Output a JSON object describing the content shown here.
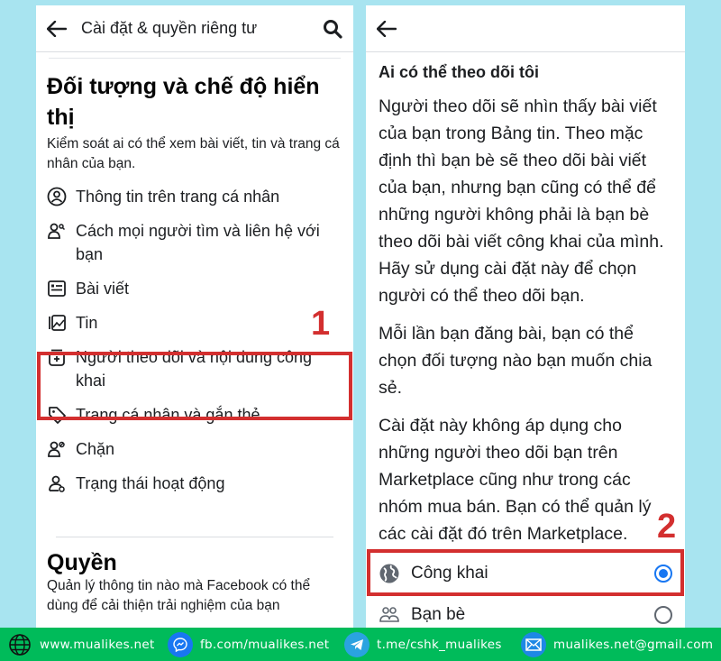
{
  "left": {
    "topbar": {
      "title": "Cài đặt & quyền riêng tư"
    },
    "section": {
      "title": "Đối tượng và chế độ hiển thị",
      "description": "Kiểm soát ai có thể xem bài viết, tin và trang cá nhân của bạn."
    },
    "menu": [
      {
        "label": "Thông tin trên trang cá nhân",
        "icon": "profile-icon"
      },
      {
        "label": "Cách mọi người tìm và liên hệ với bạn",
        "icon": "people-search-icon"
      },
      {
        "label": "Bài viết",
        "icon": "posts-icon"
      },
      {
        "label": "Tin",
        "icon": "stories-icon"
      },
      {
        "label": "Người theo dõi và nội dung công khai",
        "icon": "followers-icon",
        "highlighted": true
      },
      {
        "label": "Trang cá nhân và gắn thẻ",
        "icon": "tag-icon"
      },
      {
        "label": "Chặn",
        "icon": "block-user-icon"
      },
      {
        "label": "Trạng thái hoạt động",
        "icon": "active-status-icon"
      }
    ],
    "permissions": {
      "title": "Quyền",
      "description": "Quản lý thông tin nào mà Facebook có thể dùng để cải thiện trải nghiệm của bạn"
    },
    "step_label": "1"
  },
  "right": {
    "heading": "Ai có thể theo dõi tôi",
    "paragraphs": [
      "Người theo dõi sẽ nhìn thấy bài viết của bạn trong Bảng tin. Theo mặc định thì bạn bè sẽ theo dõi bài viết của bạn, nhưng bạn cũng có thể để những người không phải là bạn bè theo dõi bài viết công khai của mình. Hãy sử dụng cài đặt này để chọn người có thể theo dõi bạn.",
      "Mỗi lần bạn đăng bài, bạn có thể chọn đối tượng nào bạn muốn chia sẻ.",
      "Cài đặt này không áp dụng cho những người theo dõi bạn trên Marketplace cũng như trong các nhóm mua bán. Bạn có thể quản lý các cài đặt đó trên Marketplace."
    ],
    "options": [
      {
        "label": "Công khai",
        "icon": "globe-icon",
        "selected": true
      },
      {
        "label": "Bạn bè",
        "icon": "friends-icon",
        "selected": false
      }
    ],
    "step_label": "2"
  },
  "footer": {
    "website": "www.mualikes.net",
    "facebook": "fb.com/mualikes.net",
    "telegram": "t.me/cshk_mualikes",
    "email": "mualikes.net@gmail.com"
  },
  "colors": {
    "background": "#a8e4f0",
    "highlight": "#d32f2f",
    "accent": "#1877f2",
    "footer": "#00bb5a"
  }
}
